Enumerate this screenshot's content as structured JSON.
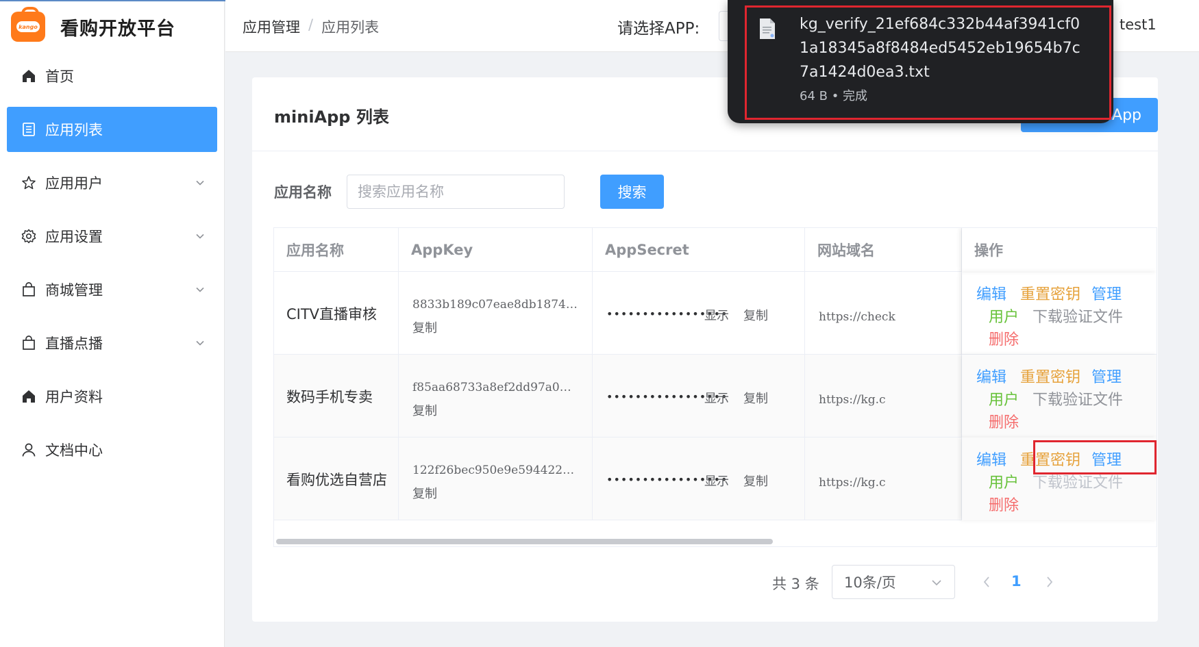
{
  "brand": {
    "logo_text": "kango",
    "title": "看购开放平台"
  },
  "sidebar": {
    "items": [
      {
        "label": "首页",
        "icon": "home-icon",
        "active": false,
        "expandable": false
      },
      {
        "label": "应用列表",
        "icon": "list-icon",
        "active": true,
        "expandable": false
      },
      {
        "label": "应用用户",
        "icon": "star-icon",
        "active": false,
        "expandable": true
      },
      {
        "label": "应用设置",
        "icon": "gear-icon",
        "active": false,
        "expandable": true
      },
      {
        "label": "商城管理",
        "icon": "shopping-bag-icon",
        "active": false,
        "expandable": true
      },
      {
        "label": "直播点播",
        "icon": "shopping-bag-icon",
        "active": false,
        "expandable": true
      },
      {
        "label": "用户资料",
        "icon": "home-icon",
        "active": false,
        "expandable": false
      },
      {
        "label": "文档中心",
        "icon": "user-icon",
        "active": false,
        "expandable": false
      }
    ]
  },
  "header": {
    "breadcrumb": [
      "应用管理",
      "应用列表"
    ],
    "breadcrumb_sep": "/",
    "app_select_label": "请选择APP:",
    "user_name": "test1"
  },
  "download": {
    "filename": "kg_verify_21ef684c332b44af3941cf01a18345a8f8484ed5452eb19654b7c7a1424d0ea3.txt",
    "meta": "64 B • 完成"
  },
  "card": {
    "title": "miniApp 列表",
    "add_button": "App"
  },
  "search": {
    "label": "应用名称",
    "placeholder": "搜索应用名称",
    "button": "搜索"
  },
  "table": {
    "columns": [
      "应用名称",
      "AppKey",
      "AppSecret",
      "网站域名",
      "操作"
    ],
    "rows": [
      {
        "name": "CITV直播审核",
        "app_key": "8833b189c07eae8db1874…",
        "secret_mask": "•••••••••••••••••",
        "domain": "https://check",
        "striped": false
      },
      {
        "name": "数码手机专卖",
        "app_key": "f85aa68733a8ef2dd97a0…",
        "secret_mask": "•••••••••••••••••",
        "domain": "https://kg.c",
        "striped": true
      },
      {
        "name": "看购优选自营店",
        "app_key": "122f26bec950e9e594422…",
        "secret_mask": "•••••••••••••••••",
        "domain": "https://kg.c",
        "striped": true
      }
    ],
    "labels": {
      "copy": "复制",
      "show": "显示",
      "edit": "编辑",
      "reset_key": "重置密钥",
      "manage": "管理",
      "users": "用户",
      "download_verify": "下载验证文件",
      "delete": "删除"
    }
  },
  "pagination": {
    "total": "共 3 条",
    "page_size": "10条/页",
    "current_page": "1"
  },
  "colors": {
    "primary": "#409eff",
    "warning": "#e6a23c",
    "success": "#67c23a",
    "danger": "#f56c6c",
    "highlight": "#e0262f",
    "popup_bg": "#202124"
  }
}
